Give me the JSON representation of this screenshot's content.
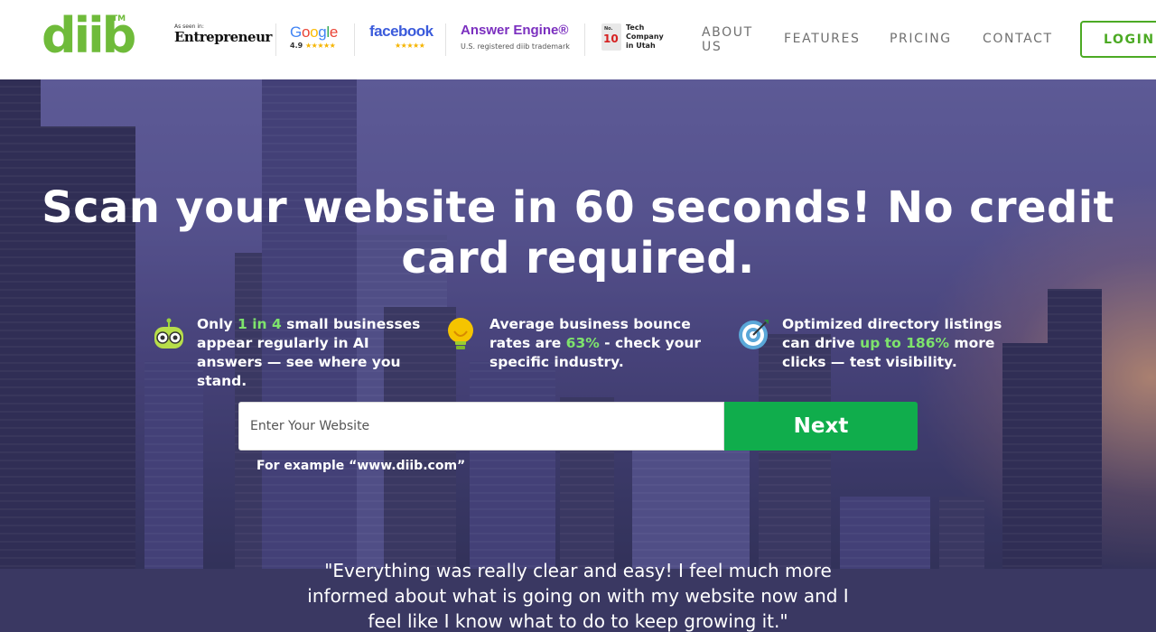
{
  "header": {
    "logo_text": "diib",
    "logo_tm": "TM",
    "press": {
      "entrepreneur": {
        "small": "As seen in:",
        "name": "Entrepreneur"
      },
      "google": {
        "name": "Google",
        "rating": "4.9",
        "stars": "★★★★★"
      },
      "facebook": {
        "name": "facebook",
        "stars": "★★★★★"
      },
      "answer_engine": {
        "name": "Answer Engine®",
        "subtitle": "U.S. registered diib trademark"
      },
      "tech_company": {
        "badge_no": "No.",
        "badge_num": "10",
        "text": "Tech Company in Utah"
      }
    },
    "nav": {
      "about": "ABOUT US",
      "features": "FEATURES",
      "pricing": "PRICING",
      "contact": "CONTACT",
      "login": "LOGIN"
    }
  },
  "hero": {
    "headline": "Scan your website in 60 seconds! No credit card required.",
    "stats": [
      {
        "pre": "Only ",
        "highlight": "1 in 4",
        "post": " small businesses appear regularly in AI answers — see where you stand.",
        "icon": "robot-icon"
      },
      {
        "pre": "Average business bounce rates are ",
        "highlight": "63%",
        "post": " - check your specific industry.",
        "icon": "lightbulb-icon"
      },
      {
        "pre": "Optimized directory listings can drive ",
        "highlight": "up to 186%",
        "post": " more clicks — test visibility.",
        "icon": "target-icon"
      }
    ],
    "input_placeholder": "Enter Your Website",
    "input_value": "",
    "next_label": "Next",
    "example_text": "For example “www.diib.com”",
    "quote": "\"Everything was really clear and easy! I feel much more informed about what is going on with my website now and I feel like I know what to do to keep growing it.\""
  },
  "colors": {
    "brand_green": "#6fbb3a",
    "login_green": "#4caa24",
    "next_green": "#10ad4c",
    "highlight_green": "#7ee36c",
    "nav_gray": "#707070"
  }
}
